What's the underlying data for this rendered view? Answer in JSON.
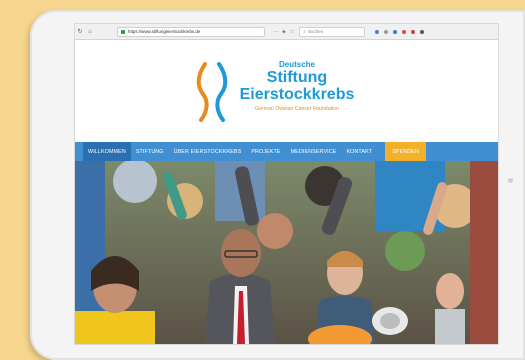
{
  "browser": {
    "url": "https://www.stiftungeierstockkrebs.de",
    "search_placeholder": "Suchen"
  },
  "logo": {
    "line1": "Deutsche",
    "line2": "Stiftung",
    "line3": "Eierstockkrebs",
    "tagline": "German Ovarian Cancer Foundation"
  },
  "nav": {
    "items": [
      {
        "label": "WILLKOMMEN"
      },
      {
        "label": "STIFTUNG"
      },
      {
        "label": "ÜBER EIERSTOCKKREBS"
      },
      {
        "label": "PROJEKTE"
      },
      {
        "label": "MEDIENSERVICE"
      },
      {
        "label": "KONTAKT"
      }
    ],
    "donate": "SPENDEN"
  },
  "colors": {
    "background": "#f6d58e",
    "brand_blue": "#1f9ad6",
    "brand_orange": "#e68c1f",
    "nav_blue": "#3f8fd2",
    "nav_active": "#2a6fb2",
    "donate": "#f3b12a"
  }
}
